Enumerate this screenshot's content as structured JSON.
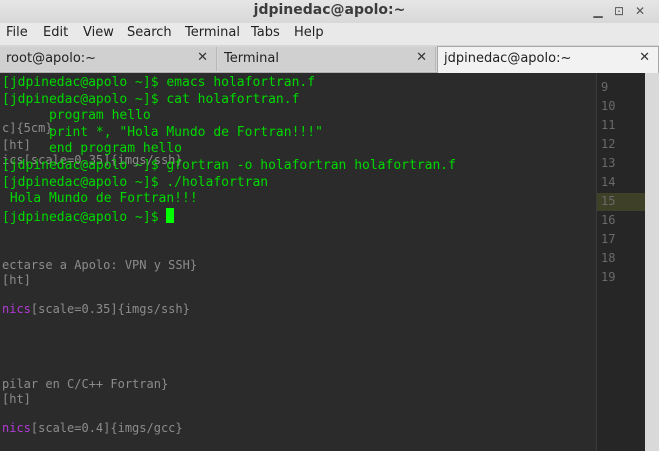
{
  "window": {
    "title": "jdpinedac@apolo:~"
  },
  "menu": [
    "File",
    "Edit",
    "View",
    "Search",
    "Terminal",
    "Tabs",
    "Help"
  ],
  "tabs": [
    {
      "label": "root@apolo:~",
      "close": "✕",
      "active": false
    },
    {
      "label": "Terminal",
      "close": "✕",
      "active": false
    },
    {
      "label": "jdpinedac@apolo:~",
      "close": "✕",
      "active": true
    }
  ],
  "terminal": {
    "lines": [
      "[jdpinedac@apolo ~]$ emacs holafortran.f",
      "[jdpinedac@apolo ~]$ cat holafortran.f",
      "      program hello",
      "      print *, \"Hola Mundo de Fortran!!!\"",
      "      end program hello",
      "[jdpinedac@apolo ~]$ gfortran -o holafortran holafortran.f",
      "[jdpinedac@apolo ~]$ ./holafortran",
      " Hola Mundo de Fortran!!!",
      "[jdpinedac@apolo ~]$ "
    ],
    "color": "#00d800"
  },
  "background_editor": {
    "fragments": [
      {
        "text": "c]{5cm}"
      },
      {
        "text": "[ht]"
      },
      {
        "text": "ics[scale=0.35]{imgs/ssh}"
      },
      {
        "text": "ectarse a Apolo: VPN y SSH}"
      },
      {
        "text": "[ht]"
      },
      {
        "prefix": "nics",
        "text": "[scale=0.35]{imgs/ssh}"
      },
      {
        "text": "pilar en C/C++ Fortran}"
      },
      {
        "text": "[ht]"
      },
      {
        "prefix": "nics",
        "text": "[scale=0.4]{imgs/gcc}"
      }
    ],
    "line_numbers": [
      "9",
      "10",
      "11",
      "12",
      "13",
      "14",
      "15",
      "16",
      "17",
      "18",
      "19"
    ]
  },
  "icons": {
    "minimize": "minimize-icon",
    "restore": "restore-icon",
    "close": "close-icon"
  }
}
